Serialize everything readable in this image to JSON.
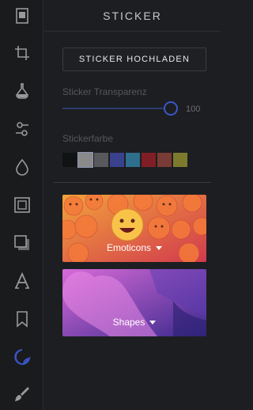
{
  "panel": {
    "title": "STICKER",
    "upload_label": "STICKER HOCHLADEN",
    "transparency_label": "Sticker Transparenz",
    "transparency_value": "100",
    "color_label": "Stickerfarbe",
    "swatches": [
      "#111214",
      "#8a8a8a",
      "#58595c",
      "#3a418d",
      "#2d6f8c",
      "#7f1f25",
      "#7a3a35",
      "#7d7a2e"
    ],
    "selected_swatch_index": 1
  },
  "categories": [
    {
      "label": "Emoticons",
      "gradient": [
        "#f2a23a",
        "#d23a4e"
      ]
    },
    {
      "label": "Shapes",
      "gradient": [
        "#d86ad8",
        "#3a2a8e"
      ]
    }
  ],
  "toolbar": {
    "items": [
      "image-icon",
      "crop-icon",
      "flask-icon",
      "adjust-icon",
      "drop-icon",
      "frame-icon",
      "shadow-square-icon",
      "text-icon",
      "bookmark-icon",
      "sticker-icon",
      "brush-icon"
    ],
    "active": "sticker-icon"
  },
  "colors": {
    "accent": "#3b56c8",
    "background": "#1d1e21"
  }
}
